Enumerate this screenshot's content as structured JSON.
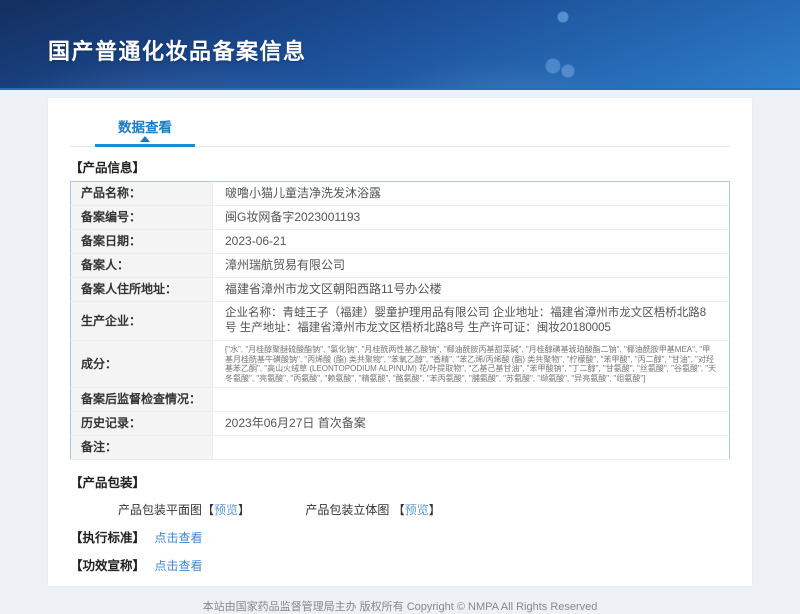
{
  "colors": {
    "accent": "#1f8ccd",
    "link": "#3f87d8",
    "preview_link": "#5b9bd5",
    "header_gradient_start": "#142e5e",
    "header_gradient_end": "#2e7ecb",
    "label_cell_bg": "#f4f4f4",
    "table_border": "#a9c7e2"
  },
  "header": {
    "title": "国产普通化妆品备案信息"
  },
  "tabs": {
    "data_view": "数据查看"
  },
  "product_info": {
    "section_title": "【产品信息】",
    "rows": [
      {
        "label": "产品名称：",
        "value": "啵噜小猫儿童洁净洗发沐浴露"
      },
      {
        "label": "备案编号：",
        "value": "闽G妆网备字2023001193"
      },
      {
        "label": "备案日期：",
        "value": "2023-06-21"
      },
      {
        "label": "备案人：",
        "value": "漳州瑞航贸易有限公司"
      },
      {
        "label": "备案人住所地址：",
        "value": "福建省漳州市龙文区朝阳西路11号办公楼"
      },
      {
        "label": "生产企业：",
        "value": "企业名称：青蛙王子（福建）婴童护理用品有限公司 企业地址：福建省漳州市龙文区梧桥北路8号 生产地址：福建省漳州市龙文区梧桥北路8号 生产许可证：闽妆20180005"
      },
      {
        "label": "成分：",
        "value": "[\"水\", \"月桂醇聚醚硫酸酯钠\", \"氯化钠\", \"月桂酰两性基乙酸钠\", \"椰油酰胺丙基甜菜碱\", \"月桂醇磺基琥珀酸酯二钠\", \"椰油酰胺甲基MEA\", \"甲基月桂酰基牛磺酸钠\", \"丙烯酸 (酯) 类共聚物\", \"苯氧乙醇\", \"香精\", \"苯乙烯/丙烯酸 (酯) 类共聚物\", \"柠檬酸\", \"苯甲酸\", \"丙二醇\", \"甘油\", \"对羟基苯乙酮\", \"高山火绒草 (LEONTOPODIUM ALPINUM) 花/叶提取物\", \"乙基己基甘油\", \"苯甲酸钠\", \"丁二醇\", \"甘氨酸\", \"丝氨酸\", \"谷氨酸\", \"天冬氨酸\", \"亮氨酸\", \"丙氨酸\", \"赖氨酸\", \"精氨酸\", \"酪氨酸\", \"苯丙氨酸\", \"脯氨酸\", \"苏氨酸\", \"缬氨酸\", \"异亮氨酸\", \"组氨酸\"]"
      },
      {
        "label": "备案后监督检查情况：",
        "value": ""
      },
      {
        "label": "历史记录：",
        "value": "2023年06月27日 首次备案"
      },
      {
        "label": "备注：",
        "value": ""
      }
    ]
  },
  "packaging": {
    "section_title": "【产品包装】",
    "flat_label": "产品包装平面图",
    "stereo_label": "产品包装立体图 ",
    "preview": "预览",
    "bracket_open": "【",
    "bracket_close": "】"
  },
  "exec_standard": {
    "title": "【执行标准】",
    "link": "点击查看"
  },
  "efficacy": {
    "title": "【功效宣称】",
    "link": "点击查看"
  },
  "footer": {
    "text": "本站由国家药品监督管理局主办 版权所有 Copyright © NMPA All Rights Reserved"
  }
}
